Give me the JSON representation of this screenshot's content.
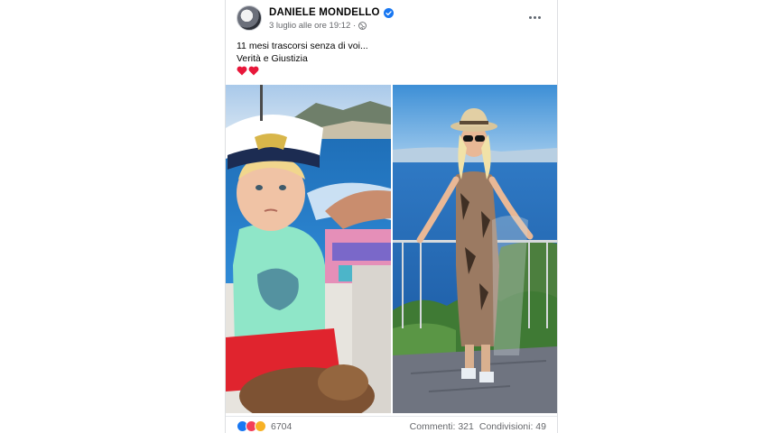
{
  "post": {
    "author_name": "DANIELE MONDELLO",
    "timestamp": "3 luglio alle ore 19:12 ·",
    "text_line1": "11 mesi trascorsi senza di voi...",
    "text_line2": "Verità e Giustizia",
    "privacy_icon": "globe-icon",
    "menu_icon": "more-horizontal-icon"
  },
  "photos": [
    {
      "description_icon": "child-photo"
    },
    {
      "description_icon": "woman-photo"
    }
  ],
  "footer": {
    "reaction_count": "6704",
    "comments": "Commenti: 321",
    "shares": "Condivisioni: 49"
  },
  "colors": {
    "like_blue": "#1877f2",
    "love_red": "#f33e58",
    "haha_yellow": "#f7b125",
    "verified_blue": "#1877f2"
  }
}
